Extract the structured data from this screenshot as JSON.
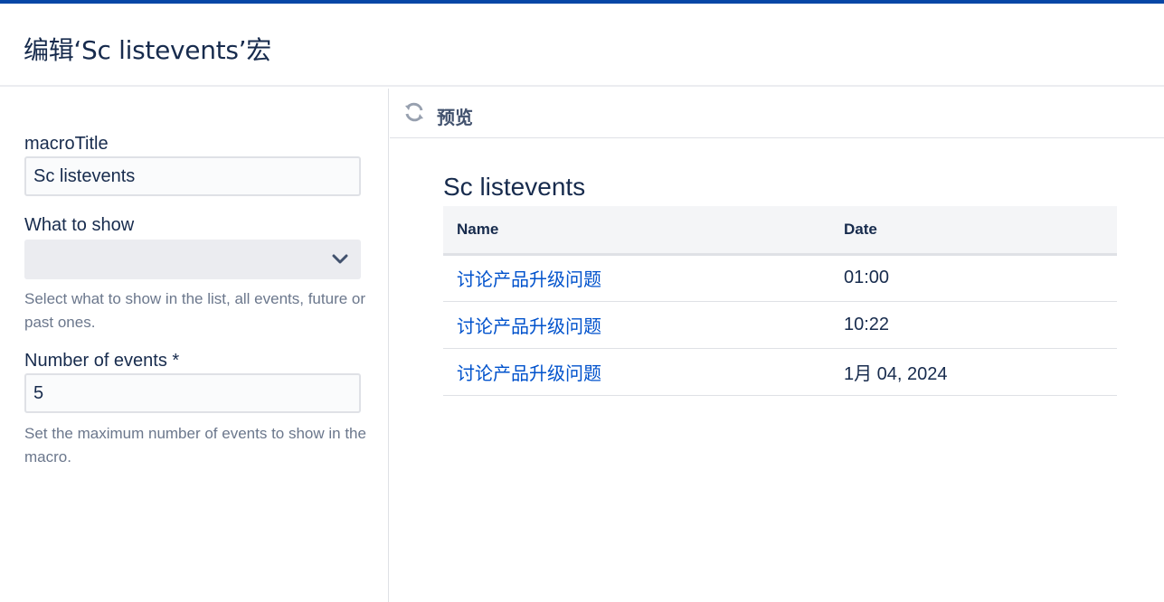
{
  "dialog": {
    "title": "编辑‘Sc listevents’宏"
  },
  "form": {
    "macro_title": {
      "label": "macroTitle",
      "value": "Sc listevents"
    },
    "what_to_show": {
      "label": "What to show",
      "selected": "",
      "help": "Select what to show in the list, all events, future or past ones."
    },
    "number_of_events": {
      "label": "Number of events *",
      "value": "5",
      "help": "Set the maximum number of events to show in the macro."
    }
  },
  "preview": {
    "label": "预览",
    "macro_title": "Sc listevents",
    "table": {
      "headers": [
        "Name",
        "Date"
      ],
      "rows": [
        {
          "name": "讨论产品升级问题",
          "date": "01:00"
        },
        {
          "name": "讨论产品升级问题",
          "date": "10:22"
        },
        {
          "name": "讨论产品升级问题",
          "date": "1月 04, 2024"
        }
      ]
    }
  },
  "colors": {
    "link": "#0052cc",
    "text": "#172b4d",
    "muted": "#6b778c",
    "top_strip": "#0747a6"
  },
  "icons": {
    "preview_icon": "refresh-icon",
    "select_icon": "chevron-down-icon"
  }
}
